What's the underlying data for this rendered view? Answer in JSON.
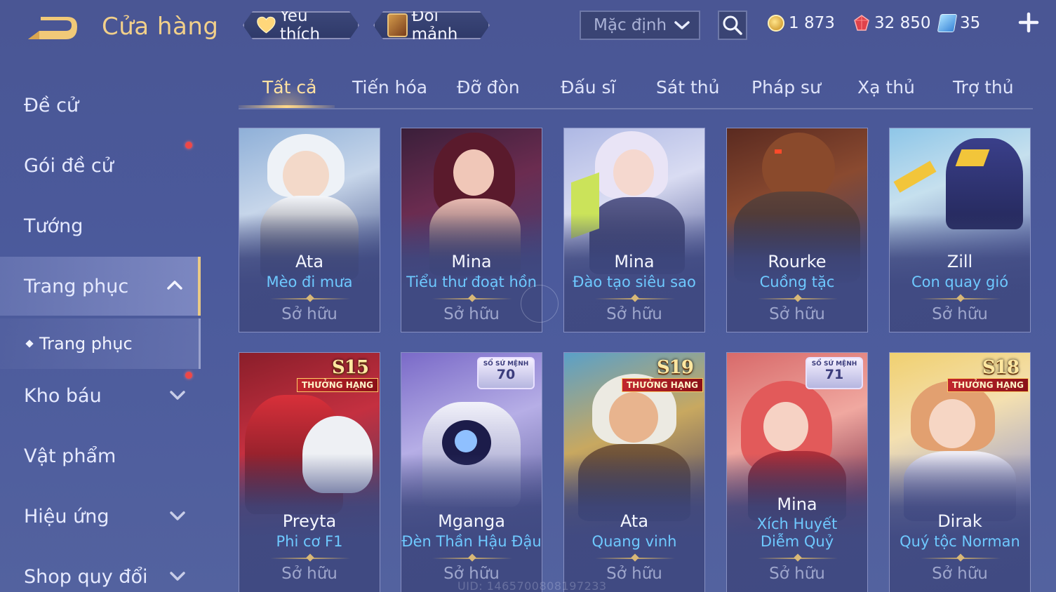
{
  "header": {
    "title": "Cửa hàng",
    "favorites_label": "Yêu thích",
    "exchange_label": "Đổi mảnh",
    "sort_label": "Mặc định"
  },
  "currencies": {
    "gold": "1 873",
    "ruby": "32 850",
    "voucher": "35"
  },
  "sidebar": {
    "items": [
      {
        "label": "Đề cử"
      },
      {
        "label": "Gói đề cử"
      },
      {
        "label": "Tướng"
      },
      {
        "label": "Trang phục"
      },
      {
        "label": "Kho báu"
      },
      {
        "label": "Vật phẩm"
      },
      {
        "label": "Hiệu ứng"
      },
      {
        "label": "Shop quy đổi"
      }
    ],
    "sub_item": "Trang phục"
  },
  "tabs": [
    "Tất cả",
    "Tiến hóa",
    "Đỡ đòn",
    "Đấu sĩ",
    "Sát thủ",
    "Pháp sư",
    "Xạ thủ",
    "Trợ thủ"
  ],
  "cards": [
    {
      "hero": "Ata",
      "skin": "Mèo đi mưa",
      "status": "Sở hữu"
    },
    {
      "hero": "Mina",
      "skin": "Tiểu thư đoạt hồn",
      "status": "Sở hữu"
    },
    {
      "hero": "Mina",
      "skin": "Đào tạo siêu sao",
      "status": "Sở hữu"
    },
    {
      "hero": "Rourke",
      "skin": "Cuồng tặc",
      "status": "Sở hữu"
    },
    {
      "hero": "Zill",
      "skin": "Con quay gió",
      "status": "Sở hữu"
    },
    {
      "hero": "Preyta",
      "skin": "Phi cơ F1",
      "status": "Sở hữu",
      "season": "S15",
      "rank_label": "THƯỞNG HẠNG"
    },
    {
      "hero": "Mganga",
      "skin": "Đèn Thần Hậu Đậu",
      "status": "Sở hữu",
      "mission_label": "SỔ SỨ MỆNH",
      "mission_num": "70"
    },
    {
      "hero": "Ata",
      "skin": "Quang vinh",
      "status": "Sở hữu",
      "season": "S19",
      "rank_label": "THƯỞNG HẠNG"
    },
    {
      "hero": "Mina",
      "skin": "Xích Huyết Diễm Quỷ",
      "status": "Sở hữu",
      "mission_label": "SỔ SỨ MỆNH",
      "mission_num": "71"
    },
    {
      "hero": "Dirak",
      "skin": "Quý tộc Norman",
      "status": "Sở hữu",
      "season": "S18",
      "rank_label": "THƯỞNG HẠNG"
    }
  ],
  "uid": "UID: 1465700808197233",
  "colors": {
    "accent_gold": "#f2d08a",
    "skin_name_blue": "#6ec9ff",
    "notification_red": "#ef4747"
  }
}
